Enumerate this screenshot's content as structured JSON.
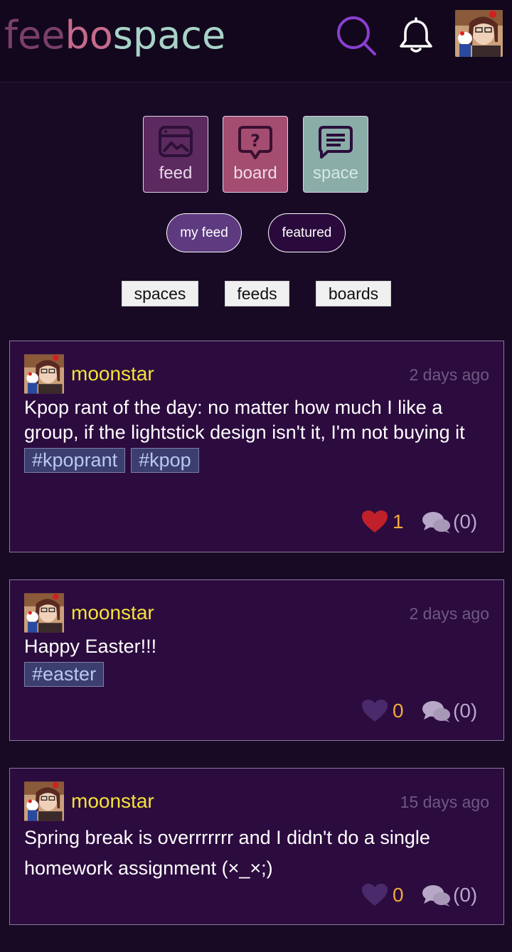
{
  "header": {
    "logo_part1": "fee",
    "logo_part2": "bo",
    "logo_part3": "space",
    "search_icon": "search-icon",
    "bell_icon": "bell-icon"
  },
  "categories": [
    {
      "label": "feed",
      "icon": "image-icon"
    },
    {
      "label": "board",
      "icon": "question-bubble-icon"
    },
    {
      "label": "space",
      "icon": "chat-icon"
    }
  ],
  "pills": {
    "my_feed": "my feed",
    "featured": "featured"
  },
  "tabs": {
    "spaces": "spaces",
    "feeds": "feeds",
    "boards": "boards"
  },
  "posts": [
    {
      "user": "moonstar",
      "time": "2 days ago",
      "text": "Kpop rant of the day: no matter how much I like a group, if the lightstick design isn't it, I'm not buying it",
      "tags": [
        "#kpoprant",
        "#kpop"
      ],
      "likes": "1",
      "liked": true,
      "comments": "(0)"
    },
    {
      "user": "moonstar",
      "time": "2 days ago",
      "text": "Happy Easter!!!",
      "tags": [
        "#easter"
      ],
      "likes": "0",
      "liked": false,
      "comments": "(0)"
    },
    {
      "user": "moonstar",
      "time": "15 days ago",
      "text": "Spring break is overrrrrrr and I didn't do a single homework assignment (×_×;)",
      "tags": [],
      "likes": "0",
      "liked": false,
      "comments": "(0)"
    }
  ],
  "colors": {
    "background": "#180a24",
    "card": "#2c0b3f",
    "username": "#f4e23a",
    "liked_heart": "#c0202a",
    "unliked_heart": "#4a2a6a",
    "like_count": "#f0a83a"
  }
}
